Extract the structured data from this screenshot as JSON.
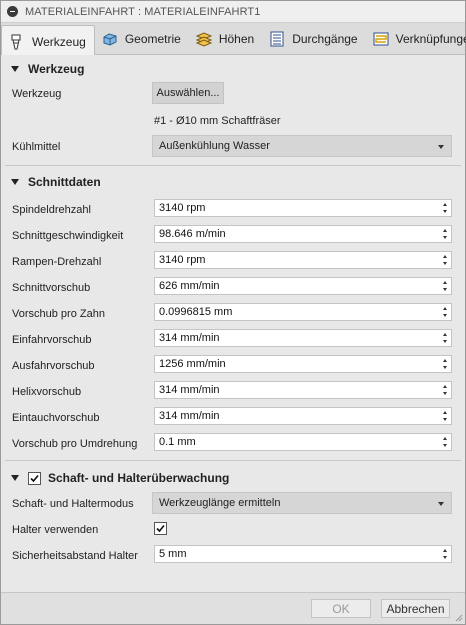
{
  "window": {
    "title": "MATERIALEINFAHRT : MATERIALEINFAHRT1"
  },
  "tabs": [
    {
      "label": "Werkzeug",
      "icon": "tool-icon",
      "active": true
    },
    {
      "label": "Geometrie",
      "icon": "geometry-cube-icon"
    },
    {
      "label": "Höhen",
      "icon": "heights-icon"
    },
    {
      "label": "Durchgänge",
      "icon": "passes-icon"
    },
    {
      "label": "Verknüpfungen",
      "icon": "linking-icon"
    }
  ],
  "werkzeug": {
    "header": "Werkzeug",
    "tool_label": "Werkzeug",
    "select_button": "Auswählen...",
    "tool_description": "#1 - Ø10 mm Schaftfräser",
    "coolant_label": "Kühlmittel",
    "coolant_value": "Außenkühlung Wasser"
  },
  "schnittdaten": {
    "header": "Schnittdaten",
    "fields": [
      {
        "label": "Spindeldrehzahl",
        "value": "3140 rpm"
      },
      {
        "label": "Schnittgeschwindigkeit",
        "value": "98.646 m/min"
      },
      {
        "label": "Rampen-Drehzahl",
        "value": "3140 rpm"
      },
      {
        "label": "Schnittvorschub",
        "value": "626 mm/min"
      },
      {
        "label": "Vorschub pro Zahn",
        "value": "0.0996815 mm"
      },
      {
        "label": "Einfahrvorschub",
        "value": "314 mm/min"
      },
      {
        "label": "Ausfahrvorschub",
        "value": "1256 mm/min"
      },
      {
        "label": "Helixvorschub",
        "value": "314 mm/min"
      },
      {
        "label": "Eintauchvorschub",
        "value": "314 mm/min"
      },
      {
        "label": "Vorschub pro Umdrehung",
        "value": "0.1 mm"
      }
    ]
  },
  "halter": {
    "header": "Schaft- und Halterüberwachung",
    "enabled": true,
    "mode_label": "Schaft- und Haltermodus",
    "mode_value": "Werkzeuglänge ermitteln",
    "use_holder_label": "Halter verwenden",
    "use_holder_checked": true,
    "clearance_label": "Sicherheitsabstand Halter",
    "clearance_value": "5 mm"
  },
  "footer": {
    "ok": "OK",
    "cancel": "Abbrechen"
  }
}
